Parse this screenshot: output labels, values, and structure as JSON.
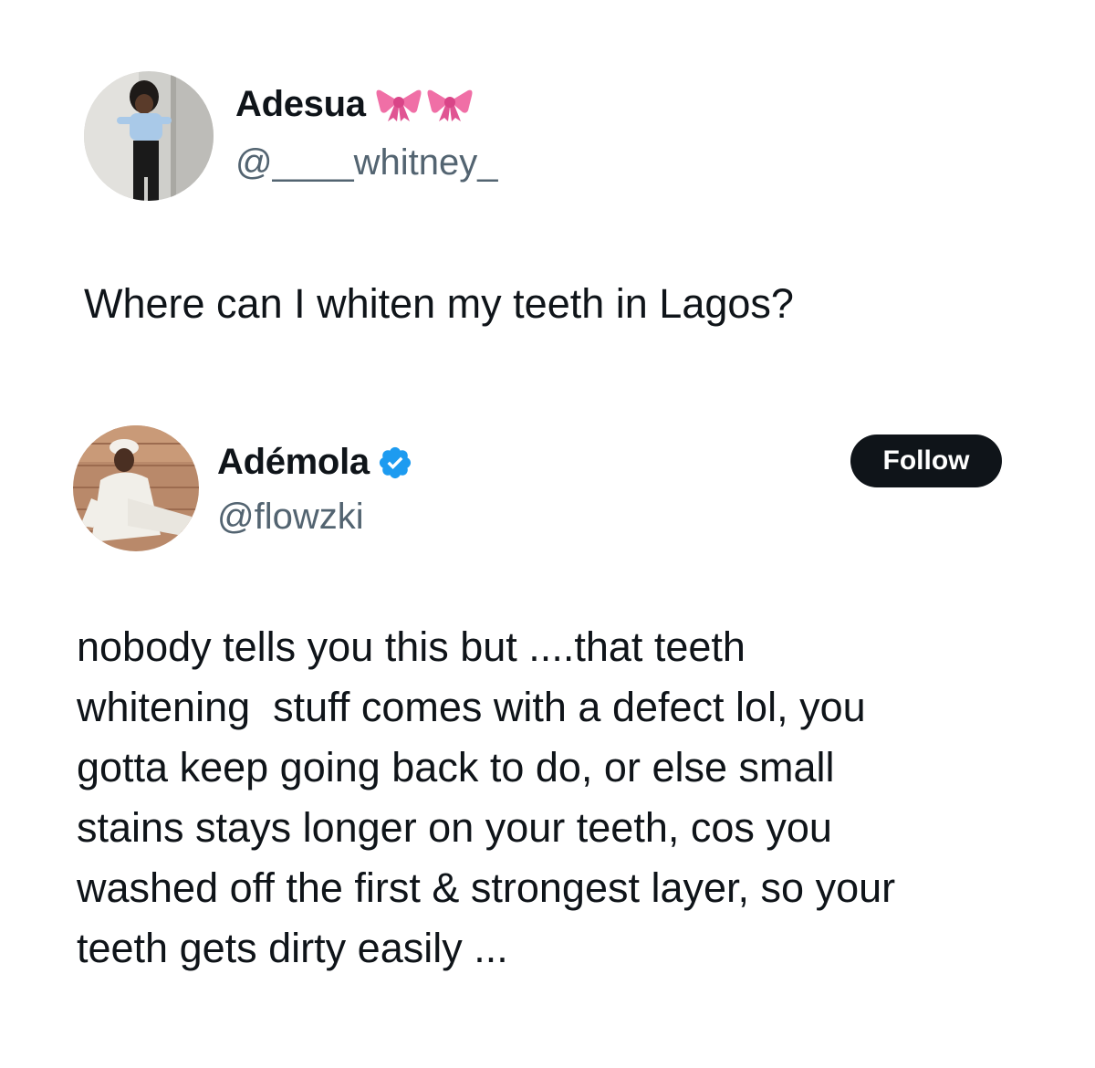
{
  "tweets": [
    {
      "display_name": "Adesua",
      "name_decorations": [
        "bow-icon",
        "bow-icon"
      ],
      "handle": "@____whitney_",
      "text": "Where can I whiten my teeth in Lagos?"
    },
    {
      "display_name": "Adémola",
      "verified": true,
      "handle": "@flowzki",
      "follow_label": "Follow",
      "text_lines": [
        "nobody tells you this but ....that teeth",
        "whitening  stuff comes with a defect lol, you",
        "gotta keep going back to do, or else small",
        "stains stays longer on your teeth, cos you",
        "washed off the first & strongest layer, so your",
        "teeth gets dirty easily ..."
      ]
    }
  ],
  "colors": {
    "text": "#0f1419",
    "handle": "#536471",
    "verified": "#1d9bf0",
    "bow": "#f06fa6",
    "follow_bg": "#0f1419",
    "follow_text": "#ffffff"
  }
}
